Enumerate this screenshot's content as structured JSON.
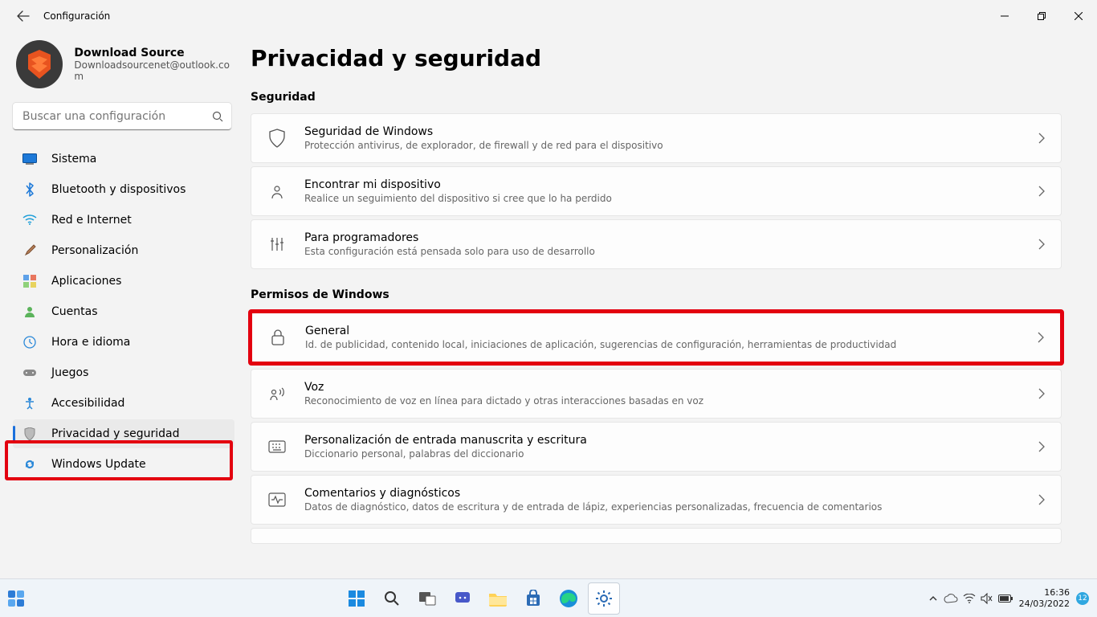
{
  "app": {
    "title": "Configuración"
  },
  "account": {
    "name": "Download Source",
    "email": "Downloadsourcenet@outlook.com"
  },
  "search": {
    "placeholder": "Buscar una configuración"
  },
  "sidebar": {
    "items": [
      {
        "label": "Sistema"
      },
      {
        "label": "Bluetooth y dispositivos"
      },
      {
        "label": "Red e Internet"
      },
      {
        "label": "Personalización"
      },
      {
        "label": "Aplicaciones"
      },
      {
        "label": "Cuentas"
      },
      {
        "label": "Hora e idioma"
      },
      {
        "label": "Juegos"
      },
      {
        "label": "Accesibilidad"
      },
      {
        "label": "Privacidad y seguridad"
      },
      {
        "label": "Windows Update"
      }
    ]
  },
  "page": {
    "title": "Privacidad y seguridad"
  },
  "sections": {
    "security": {
      "header": "Seguridad",
      "items": [
        {
          "title": "Seguridad de Windows",
          "sub": "Protección antivirus, de explorador, de firewall y de red para el dispositivo"
        },
        {
          "title": "Encontrar mi dispositivo",
          "sub": "Realice un seguimiento del dispositivo si cree que lo ha perdido"
        },
        {
          "title": "Para programadores",
          "sub": "Esta configuración está pensada solo para uso de desarrollo"
        }
      ]
    },
    "permissions": {
      "header": "Permisos de Windows",
      "items": [
        {
          "title": "General",
          "sub": "Id. de publicidad, contenido local, iniciaciones de aplicación, sugerencias de configuración, herramientas de productividad"
        },
        {
          "title": "Voz",
          "sub": "Reconocimiento de voz en línea para dictado y otras interacciones basadas en voz"
        },
        {
          "title": "Personalización de entrada manuscrita y escritura",
          "sub": "Diccionario personal, palabras del diccionario"
        },
        {
          "title": "Comentarios y diagnósticos",
          "sub": "Datos de diagnóstico, datos de escritura y de entrada de lápiz, experiencias personalizadas, frecuencia de comentarios"
        }
      ]
    }
  },
  "taskbar": {
    "time": "16:36",
    "date": "24/03/2022",
    "badge": "12"
  },
  "highlight": {
    "sidebar_index": 9,
    "card_section": "permissions",
    "card_index": 0
  }
}
